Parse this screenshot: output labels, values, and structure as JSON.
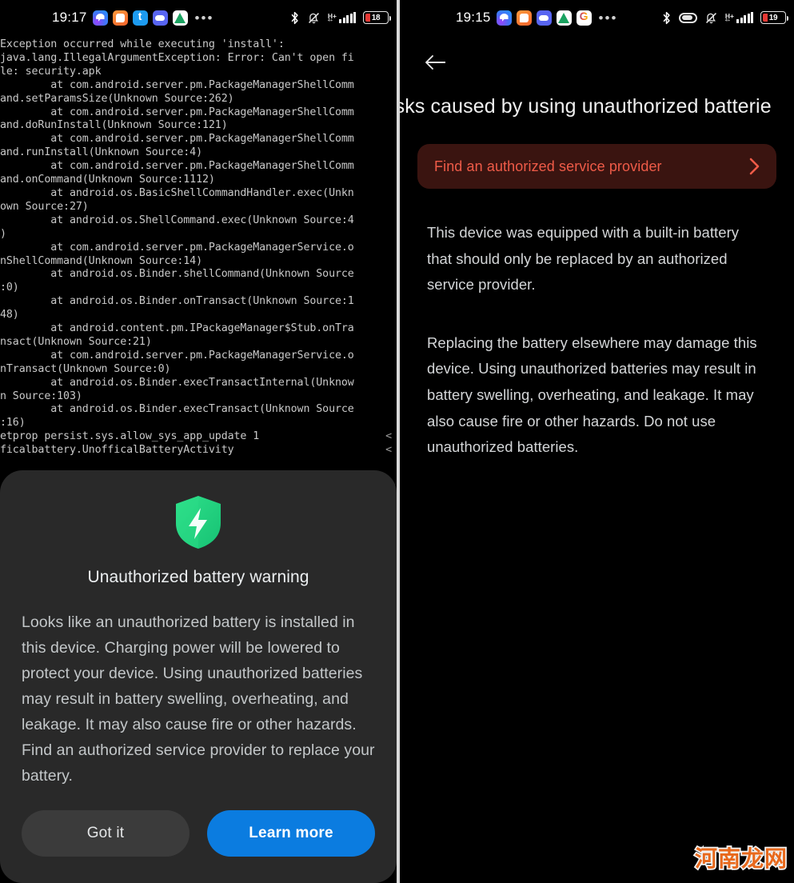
{
  "left_panel": {
    "status_bar": {
      "clock": "19:17",
      "app_icons": [
        "messenger-icon",
        "orange-app-icon",
        "twitter-icon",
        "discord-icon",
        "drive-icon"
      ],
      "overflow": "•••",
      "system_icons": [
        "bluetooth-icon",
        "notifications-muted-icon",
        "signal-hplus-icon",
        "battery-icon"
      ],
      "network_type": "H+",
      "network_sub": "4+",
      "battery_level": "18"
    },
    "terminal": {
      "lines": [
        "Exception occurred while executing 'install':",
        "java.lang.IllegalArgumentException: Error: Can't open fi",
        "le: security.apk",
        "        at com.android.server.pm.PackageManagerShellComm",
        "and.setParamsSize(Unknown Source:262)",
        "        at com.android.server.pm.PackageManagerShellComm",
        "and.doRunInstall(Unknown Source:121)",
        "        at com.android.server.pm.PackageManagerShellComm",
        "and.runInstall(Unknown Source:4)",
        "        at com.android.server.pm.PackageManagerShellComm",
        "and.onCommand(Unknown Source:1112)",
        "        at android.os.BasicShellCommandHandler.exec(Unkn",
        "own Source:27)",
        "        at android.os.ShellCommand.exec(Unknown Source:4",
        ")",
        "        at com.android.server.pm.PackageManagerService.o",
        "nShellCommand(Unknown Source:14)",
        "        at android.os.Binder.shellCommand(Unknown Source",
        ":0)",
        "        at android.os.Binder.onTransact(Unknown Source:1",
        "48)",
        "        at android.content.pm.IPackageManager$Stub.onTra",
        "nsact(Unknown Source:21)",
        "        at com.android.server.pm.PackageManagerService.o",
        "nTransact(Unknown Source:0)",
        "        at android.os.Binder.execTransactInternal(Unknow",
        "n Source:103)",
        "        at android.os.Binder.execTransact(Unknown Source",
        ":16)"
      ],
      "cmd_lines": [
        {
          "text": "etprop persist.sys.allow_sys_app_update 1",
          "right": "<"
        },
        {
          "text": "ficalbattery.UnofficalBatteryActivity",
          "right": "<"
        }
      ]
    },
    "dialog": {
      "icon": "green-shield-bolt-icon",
      "title": "Unauthorized battery warning",
      "body": "Looks like an unauthorized battery is installed in this device. Charging power will be lowered to protect your device. Using unauthorized batteries may result in battery swelling, overheating, and leakage. It may also cause fire or other hazards. Find an authorized service provider to replace your battery.",
      "secondary_button": "Got it",
      "primary_button": "Learn more",
      "primary_color": "#0b7ce0",
      "secondary_color": "#3b3b3b",
      "shield_color": "#25d07d",
      "sheet_color": "#292929"
    }
  },
  "right_panel": {
    "status_bar": {
      "clock": "19:15",
      "app_icons": [
        "messenger-icon",
        "orange-app-icon",
        "discord-icon",
        "drive-icon",
        "gmail-icon"
      ],
      "overflow": "•••",
      "system_icons": [
        "bluetooth-icon",
        "power-saver-icon",
        "notifications-muted-icon",
        "signal-hplus-icon",
        "battery-icon"
      ],
      "network_type": "H+",
      "network_sub": "4+",
      "battery_level": "19"
    },
    "back_button": "back-arrow-icon",
    "title": "isks caused by using unauthorized batterie",
    "banner": {
      "label": "Find an authorized service provider",
      "chevron": "chevron-right-icon",
      "background": "#3a1410",
      "text_color": "#ef5b48"
    },
    "paragraphs": [
      "This device was equipped with a built-in battery that should only be replaced by an authorized service provider.",
      "Replacing the battery elsewhere may damage this device. Using unauthorized batteries may result in battery swelling, overheating, and leakage. It may also cause fire or other hazards. Do not use unauthorized batteries."
    ]
  },
  "watermark": "河南龙网"
}
